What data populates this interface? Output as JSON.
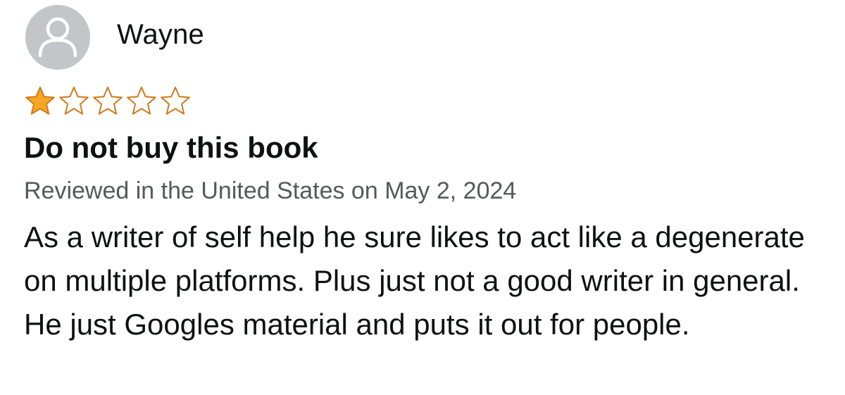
{
  "review": {
    "author": {
      "name": "Wayne",
      "avatar_icon": "default-user-avatar-icon"
    },
    "rating": {
      "value": 1,
      "max": 5,
      "filled_color": "#f5a623",
      "empty_color": "#d07a1a"
    },
    "title": "Do not buy this book",
    "meta": "Reviewed in the United States on May 2, 2024",
    "body": "As a writer of self help he sure likes to act like a degenerate on multiple platforms. Plus just not a good writer in general. He just Googles material and puts it out for people."
  },
  "colors": {
    "text": "#0f1111",
    "meta_text": "#565959",
    "avatar_bg": "#c3c6c9"
  }
}
